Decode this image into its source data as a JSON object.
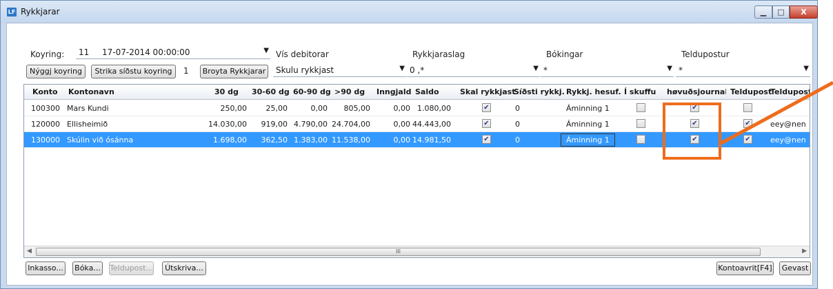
{
  "window": {
    "title": "Rykkjarar",
    "icon_text": "LF",
    "min_label": "▁",
    "max_label": "□",
    "close_label": "X"
  },
  "filters": {
    "koyring_label": "Koyring:",
    "koyring_number": "11",
    "koyring_date": "17-07-2014 00:00:00",
    "vis_debitorar_label": "Vís debitorar",
    "vis_debitorar_value": "Skulu rykkjast",
    "rykkjaraslag_label": "Rykkjaraslag",
    "rykkjaraslag_value": "0 ,*",
    "bokingar_label": "Bókingar",
    "bokingar_value": "*",
    "teldupostur_label": "Teldupostur",
    "teldupostur_value": "*",
    "koyring_count": "1"
  },
  "toolbar": {
    "new_run": "Nýggj koyring",
    "delete_last_run": "Strika síðstu koyring",
    "change_reminders": "Broyta Rykkjarar"
  },
  "grid": {
    "headers": [
      "Konto",
      "Kontonavn",
      "30 dg",
      "30-60 dg",
      "60-90 dg",
      ">90 dg",
      "Inngjald",
      "Saldo",
      "Skal rykkjast",
      "Síðsti rykkj.",
      "Rykkj. hesuf.",
      "Í skuffu",
      "høvuðsjournal",
      "Teldupost",
      "Teldupost"
    ],
    "rows": [
      {
        "konto": "100300",
        "navn": "Mars Kundi",
        "d30": "250,00",
        "d3060": "25,00",
        "d6090": "0,00",
        "d90": "805,00",
        "inngjald": "0,00",
        "saldo": "1.080,00",
        "skal": true,
        "sidsti": "0",
        "hesuf": "Áminning 1",
        "skuffu": false,
        "hovud": true,
        "teldu": false,
        "email": ""
      },
      {
        "konto": "120000",
        "navn": "Ellisheimið",
        "d30": "14.030,00",
        "d3060": "919,00",
        "d6090": "4.790,00",
        "d90": "24.704,00",
        "inngjald": "0,00",
        "saldo": "44.443,00",
        "skal": true,
        "sidsti": "0",
        "hesuf": "Áminning 1",
        "skuffu": false,
        "hovud": true,
        "teldu": true,
        "email": "eey@nen"
      },
      {
        "konto": "130000",
        "navn": "Skúlin við ósánna",
        "d30": "1.698,00",
        "d3060": "362,50",
        "d6090": "1.383,00",
        "d90": "11.538,00",
        "inngjald": "0,00",
        "saldo": "14.981,50",
        "skal": true,
        "sidsti": "0",
        "hesuf": "Áminning 1",
        "skuffu": false,
        "hovud": true,
        "teldu": true,
        "email": "eey@nen"
      }
    ],
    "scroll_grip": "III"
  },
  "footer": {
    "inkasso": "Inkasso...",
    "boka": "Bóka...",
    "teldupost": "Teldupost...",
    "utskriva": "Útskriva...",
    "kontoavrit": "Kontoavrit[F4]",
    "gevast": "Gevast"
  },
  "colors": {
    "highlight": "#ef6c1c",
    "selection": "#3399ff"
  }
}
